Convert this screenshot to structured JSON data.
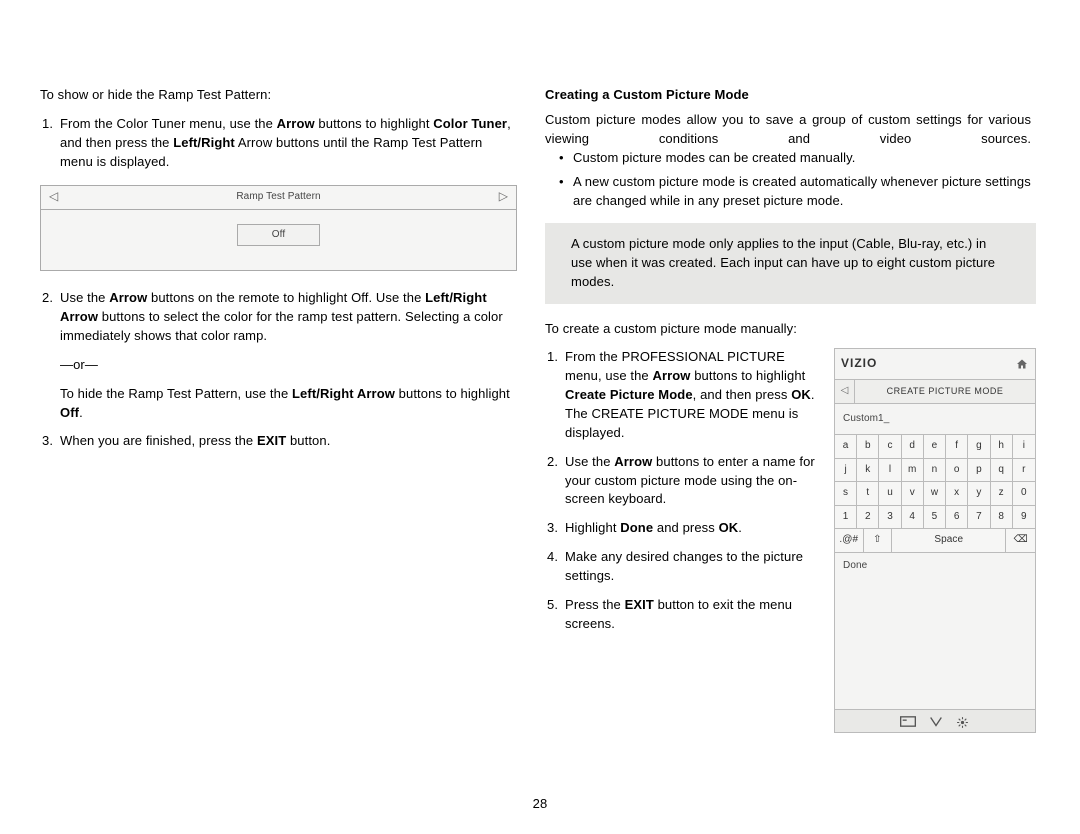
{
  "pageNumber": "28",
  "left": {
    "intro": "To show or hide the Ramp Test Pattern:",
    "step1_a": "From the Color Tuner menu, use the ",
    "step1_arrow": "Arrow",
    "step1_b": " buttons to highlight ",
    "step1_ct": "Color Tuner",
    "step1_c": ", and then press the ",
    "step1_lr": "Left/Right",
    "step1_d": " Arrow buttons until the Ramp Test Pattern menu is displayed.",
    "ramp_title": "Ramp Test Pattern",
    "ramp_off": "Off",
    "step2_a": "Use the ",
    "step2_arrow": "Arrow",
    "step2_b": " buttons on the remote to highlight Off. Use the ",
    "step2_lr": "Left/Right Arrow",
    "step2_c": " buttons to select the color for the ramp test pattern. Selecting a color immediately shows that color ramp.",
    "or": "—or—",
    "hide_a": "To hide the Ramp Test Pattern, use the ",
    "hide_b": "Left/Right Arrow",
    "hide_c": " buttons to highlight ",
    "hide_off": "Off",
    "hide_d": ".",
    "step3_a": "When you are finished, press the ",
    "step3_exit": "EXIT",
    "step3_b": " button."
  },
  "right": {
    "heading": "Creating a Custom Picture Mode",
    "intro": "Custom picture modes allow you to save a group of custom settings for various viewing conditions and video sources.",
    "bullet1": "Custom picture modes can be created manually.",
    "bullet2": "A new custom picture mode is created automatically whenever picture settings are changed while in any preset picture mode.",
    "note": "A custom picture mode only applies to the input (Cable, Blu-ray, etc.) in use when it was created. Each input can have up to eight custom picture modes.",
    "create_intro": "To create a custom picture mode manually:",
    "s1_a": "From the PROFESSIONAL PICTURE menu, use the ",
    "s1_arrow": "Arrow",
    "s1_b": " buttons to highlight ",
    "s1_cpm": "Create Picture Mode",
    "s1_c": ", and then press ",
    "s1_ok": "OK",
    "s1_d": ". The CREATE PICTURE MODE menu is displayed.",
    "s2_a": "Use the ",
    "s2_arrow": "Arrow",
    "s2_b": " buttons to enter a name for your custom picture mode using the on-screen keyboard.",
    "s3_a": "Highlight ",
    "s3_done": "Done",
    "s3_b": " and press ",
    "s3_ok": "OK",
    "s3_c": ".",
    "s4": "Make any desired changes to the picture settings.",
    "s5_a": "Press the ",
    "s5_exit": "EXIT",
    "s5_b": " button to exit the menu screens."
  },
  "device": {
    "brand": "VIZIO",
    "menuTitle": "CREATE PICTURE MODE",
    "inputValue": "Custom1_",
    "keys": [
      "a",
      "b",
      "c",
      "d",
      "e",
      "f",
      "g",
      "h",
      "i",
      "j",
      "k",
      "l",
      "m",
      "n",
      "o",
      "p",
      "q",
      "r",
      "s",
      "t",
      "u",
      "v",
      "w",
      "x",
      "y",
      "z",
      "0",
      "1",
      "2",
      "3",
      "4",
      "5",
      "6",
      "7",
      "8",
      "9"
    ],
    "sym": ".@#",
    "shift": "⇧",
    "space": "Space",
    "backspace": "⌫",
    "done": "Done",
    "arrowLeft": "◁",
    "arrowRight": "▷"
  }
}
